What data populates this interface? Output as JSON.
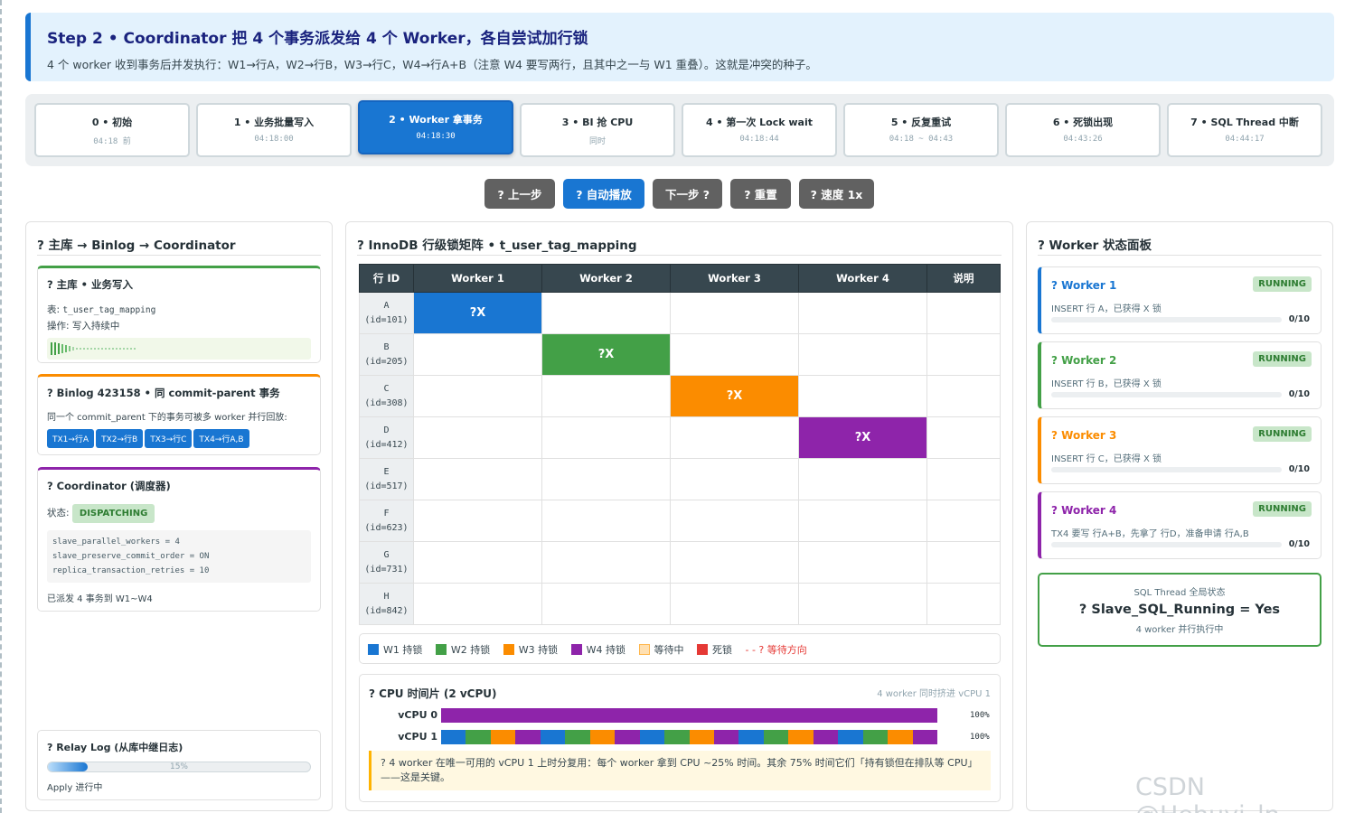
{
  "header": {
    "title": "Step 2 • Coordinator 把 4 个事务派发给 4 个 Worker，各自尝试加行锁",
    "subtitle": "4 个 worker 收到事务后并发执行：W1→行A，W2→行B，W3→行C，W4→行A+B（注意 W4 要写两行，且其中之一与 W1 重叠）。这就是冲突的种子。"
  },
  "steps": [
    {
      "title": "0 • 初始",
      "time": "04:18 前"
    },
    {
      "title": "1 • 业务批量写入",
      "time": "04:18:00"
    },
    {
      "title": "2 • Worker 拿事务",
      "time": "04:18:30"
    },
    {
      "title": "3 • BI 抢 CPU",
      "time": "同时"
    },
    {
      "title": "4 • 第一次 Lock wait",
      "time": "04:18:44"
    },
    {
      "title": "5 • 反复重试",
      "time": "04:18 ~ 04:43"
    },
    {
      "title": "6 • 死锁出现",
      "time": "04:43:26"
    },
    {
      "title": "7 • SQL Thread 中断",
      "time": "04:44:17"
    }
  ],
  "active_step": 2,
  "controls": {
    "prev": "? 上一步",
    "autoplay": "? 自动播放",
    "next": "下一步 ?",
    "reset": "? 重置",
    "speed": "? 速度 1x"
  },
  "left": {
    "title": "? 主库 → Binlog → Coordinator",
    "master": {
      "title": "? 主库 • 业务写入",
      "table_label": "表: ",
      "table_name": "t_user_tag_mapping",
      "op": "操作: 写入持续中"
    },
    "binlog": {
      "title": "? Binlog 423158 • 同 commit-parent 事务",
      "desc": "同一个 commit_parent 下的事务可被多 worker 并行回放:",
      "tags": [
        "TX1→行A",
        "TX2→行B",
        "TX3→行C",
        "TX4→行A,B"
      ]
    },
    "coordinator": {
      "title": "? Coordinator (调度器)",
      "status_label": "状态:",
      "status": "DISPATCHING",
      "config": [
        "slave_parallel_workers = 4",
        "slave_preserve_commit_order = ON",
        "replica_transaction_retries = 10"
      ],
      "footer": "已派发 4 事务到 W1~W4"
    },
    "relay": {
      "title": "? Relay Log (从库中继日志)",
      "progress": 15,
      "progress_label": "15%",
      "footer": "Apply 进行中"
    }
  },
  "middle": {
    "title": "? InnoDB 行级锁矩阵 • t_user_tag_mapping",
    "columns": [
      "行 ID",
      "Worker 1",
      "Worker 2",
      "Worker 3",
      "Worker 4",
      "说明"
    ],
    "rows": [
      {
        "name": "A",
        "id": "(id=101)",
        "lock_col": 1,
        "lock": "?X"
      },
      {
        "name": "B",
        "id": "(id=205)",
        "lock_col": 2,
        "lock": "?X"
      },
      {
        "name": "C",
        "id": "(id=308)",
        "lock_col": 3,
        "lock": "?X"
      },
      {
        "name": "D",
        "id": "(id=412)",
        "lock_col": 4,
        "lock": "?X"
      },
      {
        "name": "E",
        "id": "(id=517)",
        "lock_col": 0,
        "lock": ""
      },
      {
        "name": "F",
        "id": "(id=623)",
        "lock_col": 0,
        "lock": ""
      },
      {
        "name": "G",
        "id": "(id=731)",
        "lock_col": 0,
        "lock": ""
      },
      {
        "name": "H",
        "id": "(id=842)",
        "lock_col": 0,
        "lock": ""
      }
    ],
    "legend": [
      {
        "label": "W1 持锁",
        "color": "#1976d2"
      },
      {
        "label": "W2 持锁",
        "color": "#43a047"
      },
      {
        "label": "W3 持锁",
        "color": "#fb8c00"
      },
      {
        "label": "W4 持锁",
        "color": "#8e24aa"
      },
      {
        "label": "等待中",
        "color": "#ffe0b2"
      },
      {
        "label": "死锁",
        "color": "#e53935"
      }
    ],
    "legend_wait": "- - ? 等待方向",
    "cpu": {
      "title": "? CPU 时间片 (2 vCPU)",
      "subtitle": "4 worker 同时挤进 vCPU 1",
      "vcpu0_label": "vCPU 0",
      "vcpu0_pct": "100%",
      "vcpu0_color": "#8e24aa",
      "vcpu1_label": "vCPU 1",
      "vcpu1_pct": "100%",
      "vcpu1_pattern": [
        "#1976d2",
        "#43a047",
        "#fb8c00",
        "#8e24aa"
      ],
      "note": "? 4 worker 在唯一可用的 vCPU 1 上时分复用：每个 worker 拿到 CPU ~25% 时间。其余 75% 时间它们「持有锁但在排队等 CPU」——这是关键。"
    }
  },
  "right": {
    "title": "? Worker 状态面板",
    "workers": [
      {
        "name": "? Worker 1",
        "status": "RUNNING",
        "desc": "INSERT 行 A，已获得 X 锁",
        "progress": "0/10",
        "color": "#1976d2"
      },
      {
        "name": "? Worker 2",
        "status": "RUNNING",
        "desc": "INSERT 行 B，已获得 X 锁",
        "progress": "0/10",
        "color": "#43a047"
      },
      {
        "name": "? Worker 3",
        "status": "RUNNING",
        "desc": "INSERT 行 C，已获得 X 锁",
        "progress": "0/10",
        "color": "#fb8c00"
      },
      {
        "name": "? Worker 4",
        "status": "RUNNING",
        "desc": "TX4 要写 行A+B，先拿了 行D，准备申请 行A,B",
        "progress": "0/10",
        "color": "#8e24aa"
      }
    ],
    "sql": {
      "label": "SQL Thread 全局状态",
      "value": "? Slave_SQL_Running = Yes",
      "sub": "4 worker 并行执行中"
    }
  },
  "watermark": "CSDN @Hehuyi_ln"
}
